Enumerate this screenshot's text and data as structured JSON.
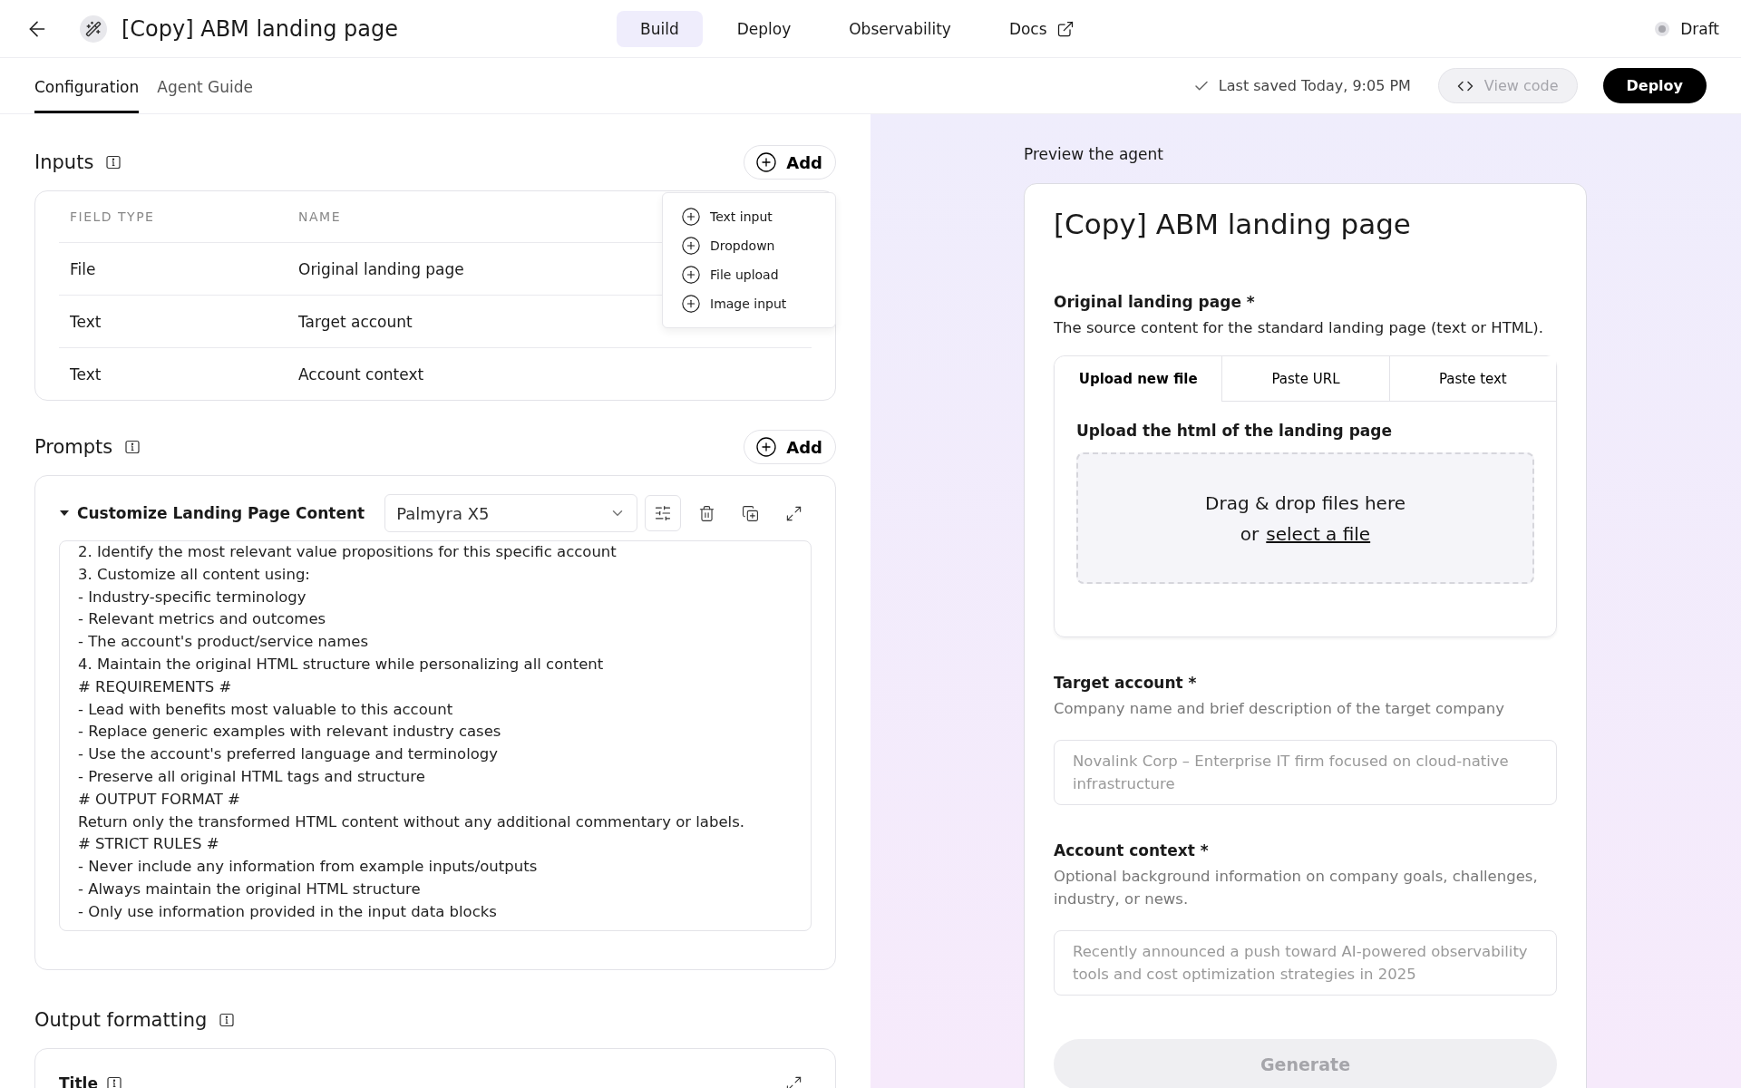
{
  "header": {
    "title": "[Copy] ABM landing page",
    "nav": [
      {
        "label": "Build",
        "selected": true
      },
      {
        "label": "Deploy",
        "selected": false
      },
      {
        "label": "Observability",
        "selected": false
      },
      {
        "label": "Docs",
        "selected": false,
        "external": true
      }
    ],
    "status": "Draft"
  },
  "subheader": {
    "tabs": [
      {
        "label": "Configuration",
        "selected": true
      },
      {
        "label": "Agent Guide",
        "selected": false
      }
    ],
    "save_status": "Last saved Today, 9:05 PM",
    "view_code": {
      "label": "View code",
      "disabled": true
    },
    "deploy": "Deploy"
  },
  "inputs": {
    "title": "Inputs",
    "add": "Add",
    "columns": [
      "FIELD TYPE",
      "NAME"
    ],
    "rows": [
      {
        "type": "File",
        "name": "Original landing page"
      },
      {
        "type": "Text",
        "name": "Target account"
      },
      {
        "type": "Text",
        "name": "Account context"
      }
    ],
    "add_menu": [
      "Text input",
      "Dropdown",
      "File upload",
      "Image input"
    ]
  },
  "prompts": {
    "title": "Prompts",
    "add": "Add",
    "items": [
      {
        "title": "Customize Landing Page Content",
        "expanded": true,
        "model": "Palmyra X5",
        "text": "2. Identify the most relevant value propositions for this specific account\n3. Customize all content using:\n- Industry-specific terminology\n- Relevant metrics and outcomes\n- The account's product/service names\n4. Maintain the original HTML structure while personalizing all content\n# REQUIREMENTS #\n- Lead with benefits most valuable to this account\n- Replace generic examples with relevant industry cases\n- Use the account's preferred language and terminology\n- Preserve all original HTML tags and structure\n# OUTPUT FORMAT #\nReturn only the transformed HTML content without any additional commentary or labels.\n# STRICT RULES #\n- Never include any information from example inputs/outputs\n- Always maintain the original HTML structure\n- Only use information provided in the input data blocks"
      }
    ]
  },
  "output_formatting": {
    "title": "Output formatting",
    "fields": [
      {
        "label": "Title"
      }
    ]
  },
  "preview": {
    "heading": "Preview the agent",
    "title": "[Copy] ABM landing page",
    "fields": [
      {
        "kind": "file",
        "label": "Original landing page *",
        "description": "The source content for the standard landing page (text or HTML).",
        "tabs": [
          {
            "label": "Upload new file",
            "selected": true
          },
          {
            "label": "Paste URL",
            "selected": false
          },
          {
            "label": "Paste text",
            "selected": false
          }
        ],
        "upload_label": "Upload the html of the landing page",
        "drop_text": "Drag & drop files here",
        "drop_prefix": "or",
        "drop_link": "select a file"
      },
      {
        "kind": "textarea",
        "label": "Target account *",
        "description": "Company name and brief description of the target company",
        "placeholder": "Novalink Corp – Enterprise IT firm focused on cloud-native infrastructure"
      },
      {
        "kind": "textarea",
        "label": "Account context *",
        "description": "Optional background information on company goals, challenges, industry, or news.",
        "placeholder": "Recently announced a push toward AI-powered observability tools and cost optimization strategies in 2025"
      }
    ],
    "generate": {
      "label": "Generate",
      "disabled": true
    }
  }
}
